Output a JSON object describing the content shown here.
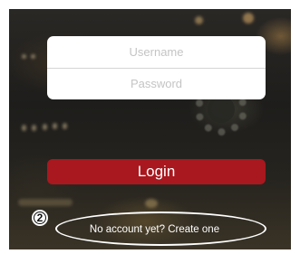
{
  "login_form": {
    "username_placeholder": "Username",
    "password_placeholder": "Password",
    "login_label": "Login"
  },
  "signup": {
    "link_label": "No account yet? Create one"
  },
  "annotation": {
    "step_number": "2"
  },
  "colors": {
    "login_button": "#a8181e",
    "annotation": "#ffffff"
  }
}
